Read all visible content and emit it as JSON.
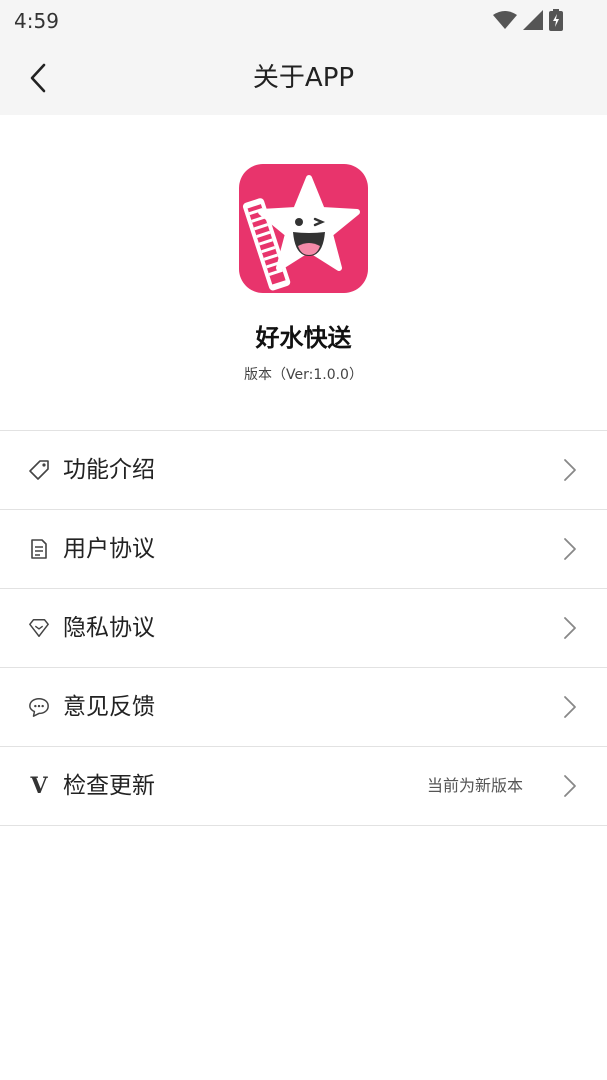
{
  "status_bar": {
    "time": "4:59"
  },
  "header": {
    "title": "关于APP"
  },
  "app": {
    "name": "好水快送",
    "version": "版本（Ver:1.0.0）"
  },
  "menu": [
    {
      "label": "功能介绍",
      "icon": "tag-icon"
    },
    {
      "label": "用户协议",
      "icon": "document-icon"
    },
    {
      "label": "隐私协议",
      "icon": "diamond-icon"
    },
    {
      "label": "意见反馈",
      "icon": "chat-bubble-icon"
    },
    {
      "label": "检查更新",
      "icon": "version-v-icon",
      "value": "当前为新版本"
    }
  ],
  "colors": {
    "logo_bg": "#e8346c",
    "topbar_bg": "#f5f5f5"
  }
}
